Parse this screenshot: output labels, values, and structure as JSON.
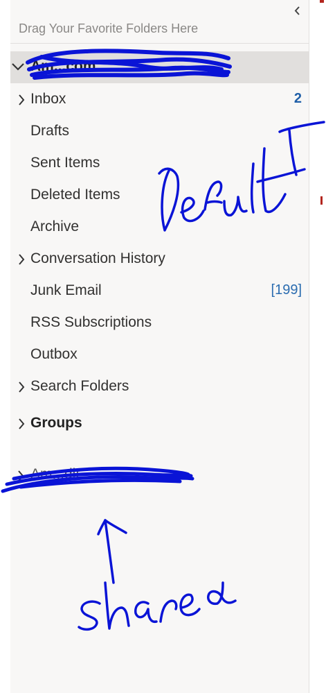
{
  "favorites": {
    "hint": "Drag Your Favorite Folders Here",
    "collapse_icon": "chevron-left-icon"
  },
  "account": {
    "name": "Am...com",
    "expanded_icon": "chevron-down-icon"
  },
  "folders": [
    {
      "label": "Inbox",
      "count": "2",
      "has_children": true
    },
    {
      "label": "Drafts",
      "count": "",
      "has_children": false
    },
    {
      "label": "Sent Items",
      "count": "",
      "has_children": false
    },
    {
      "label": "Deleted Items",
      "count": "",
      "has_children": false
    },
    {
      "label": "Archive",
      "count": "",
      "has_children": false
    },
    {
      "label": "Conversation History",
      "count": "",
      "has_children": true
    },
    {
      "label": "Junk Email",
      "count": "[199]",
      "has_children": false
    },
    {
      "label": "RSS Subscriptions",
      "count": "",
      "has_children": false
    },
    {
      "label": "Outbox",
      "count": "",
      "has_children": false
    },
    {
      "label": "Search Folders",
      "count": "",
      "has_children": true
    }
  ],
  "groups": {
    "label": "Groups"
  },
  "shared_account": {
    "name": "Am...dit"
  },
  "handwriting": {
    "default": "Default",
    "shared": "shared"
  },
  "colors": {
    "ink": "#0a14d6",
    "pane_bg": "#f8f7f6",
    "selected_bg": "#e1dfdd",
    "unread_count": "#1f5fa8"
  }
}
